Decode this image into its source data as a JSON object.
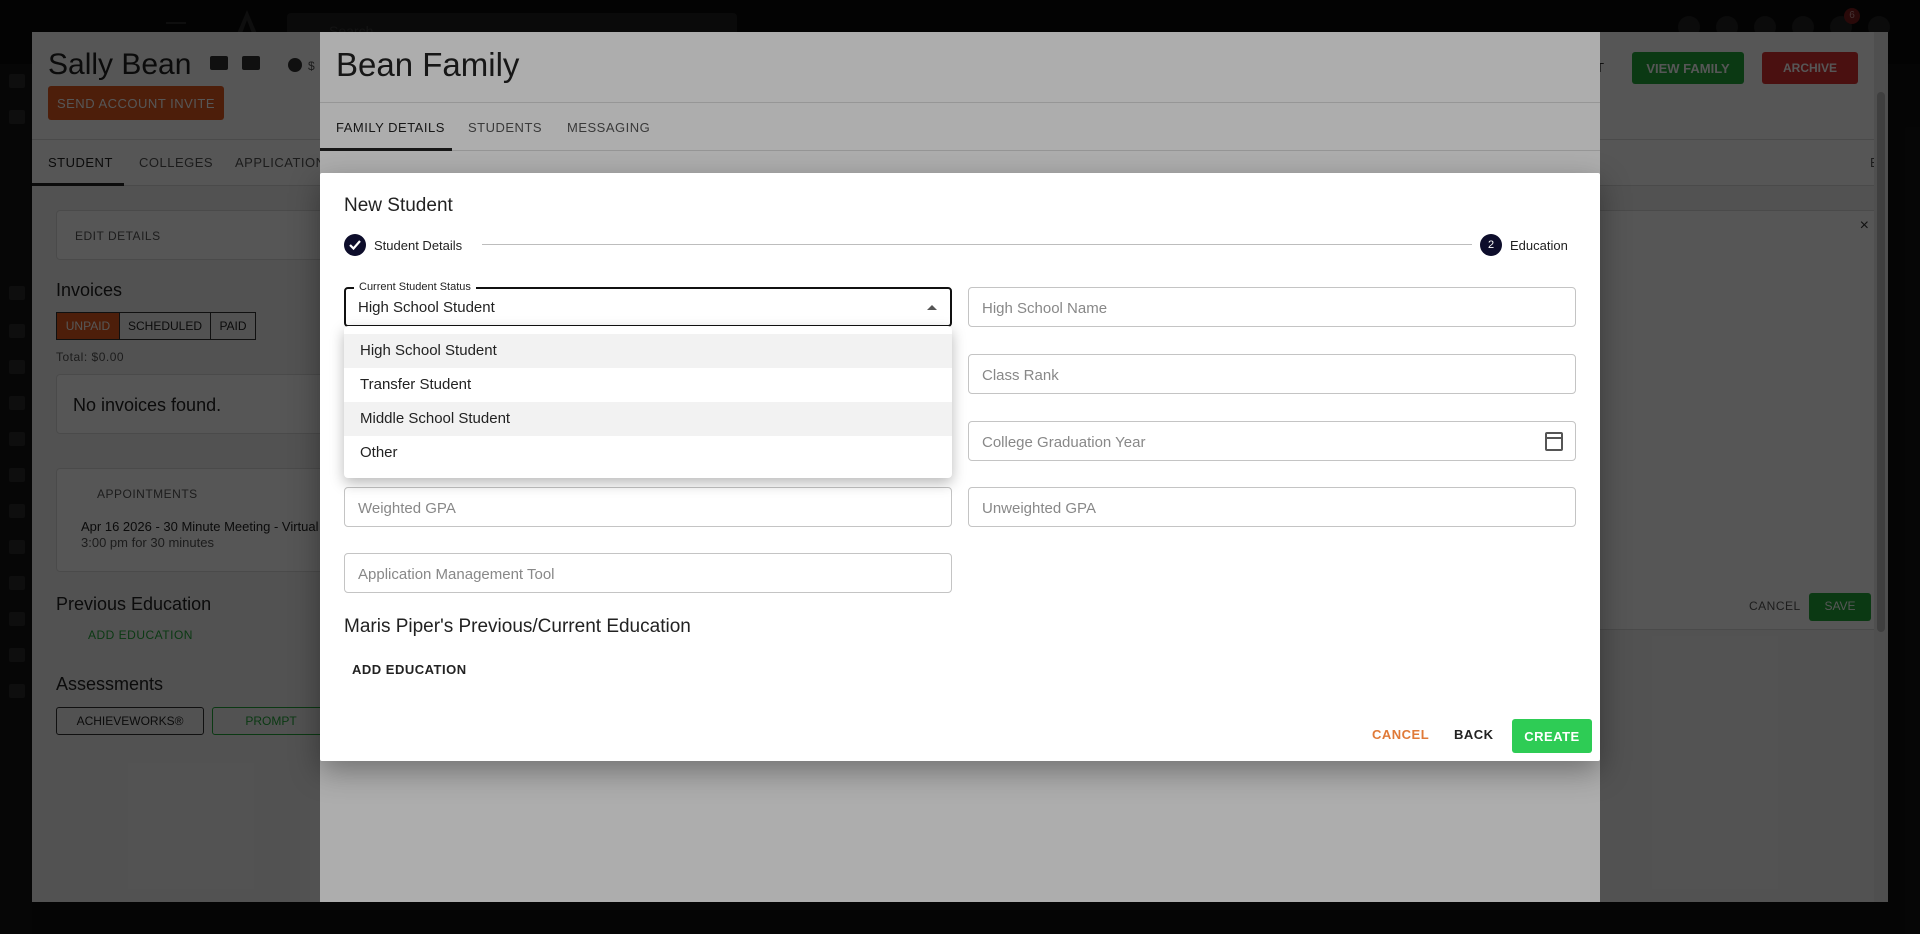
{
  "background": {
    "search_placeholder": "Search",
    "notification_count": "6",
    "student_name": "Sally Bean",
    "balance_text": "$",
    "send_invite_label": "SEND ACCOUNT INVITE",
    "header_partial_text": "RT",
    "view_family_label": "VIEW FAMILY",
    "archive_label": "ARCHIVE",
    "tabs": [
      "STUDENT",
      "COLLEGES",
      "APPLICATION"
    ],
    "right_tab_partial": "ED",
    "edit_details_label": "EDIT DETAILS",
    "invoices_title": "Invoices",
    "invoice_filters": [
      "UNPAID",
      "SCHEDULED",
      "PAID"
    ],
    "total_text": "Total: $0.00",
    "no_invoices": "No invoices found.",
    "appointments_label": "APPOINTMENTS",
    "appointment_line1": "Apr 16 2026 - 30 Minute Meeting - Virtual",
    "appointment_line2": "3:00 pm for 30 minutes",
    "prev_edu_title": "Previous Education",
    "add_education_label": "ADD EDUCATION",
    "assessments_title": "Assessments",
    "achieveworks_label": "ACHIEVEWORKS®",
    "prompt_label": "PROMPT",
    "cancel_label": "CANCEL",
    "save_label": "SAVE"
  },
  "family_modal": {
    "title": "Bean Family",
    "tabs": [
      "FAMILY DETAILS",
      "STUDENTS",
      "MESSAGING"
    ]
  },
  "dialog": {
    "title": "New Student",
    "steps": [
      {
        "label": "Student Details",
        "status": "done"
      },
      {
        "number": "2",
        "label": "Education",
        "status": "active"
      }
    ],
    "status_field": {
      "label": "Current Student Status",
      "value": "High School Student"
    },
    "fields": {
      "high_school_name": "High School Name",
      "class_rank": "Class Rank",
      "college_grad_year": "College Graduation Year",
      "weighted_gpa": "Weighted GPA",
      "unweighted_gpa": "Unweighted GPA",
      "app_mgmt_tool": "Application Management Tool"
    },
    "education_title": "Maris Piper's Previous/Current Education",
    "add_education_label": "ADD EDUCATION",
    "cancel_label": "CANCEL",
    "back_label": "BACK",
    "create_label": "CREATE"
  },
  "dropdown": {
    "options": [
      "High School Student",
      "Transfer Student",
      "Middle School Student",
      "Other"
    ]
  },
  "colors": {
    "create_green": "#2ecc55",
    "cancel_orange": "#e07a38",
    "stepper_dark": "#0d0d2b"
  }
}
